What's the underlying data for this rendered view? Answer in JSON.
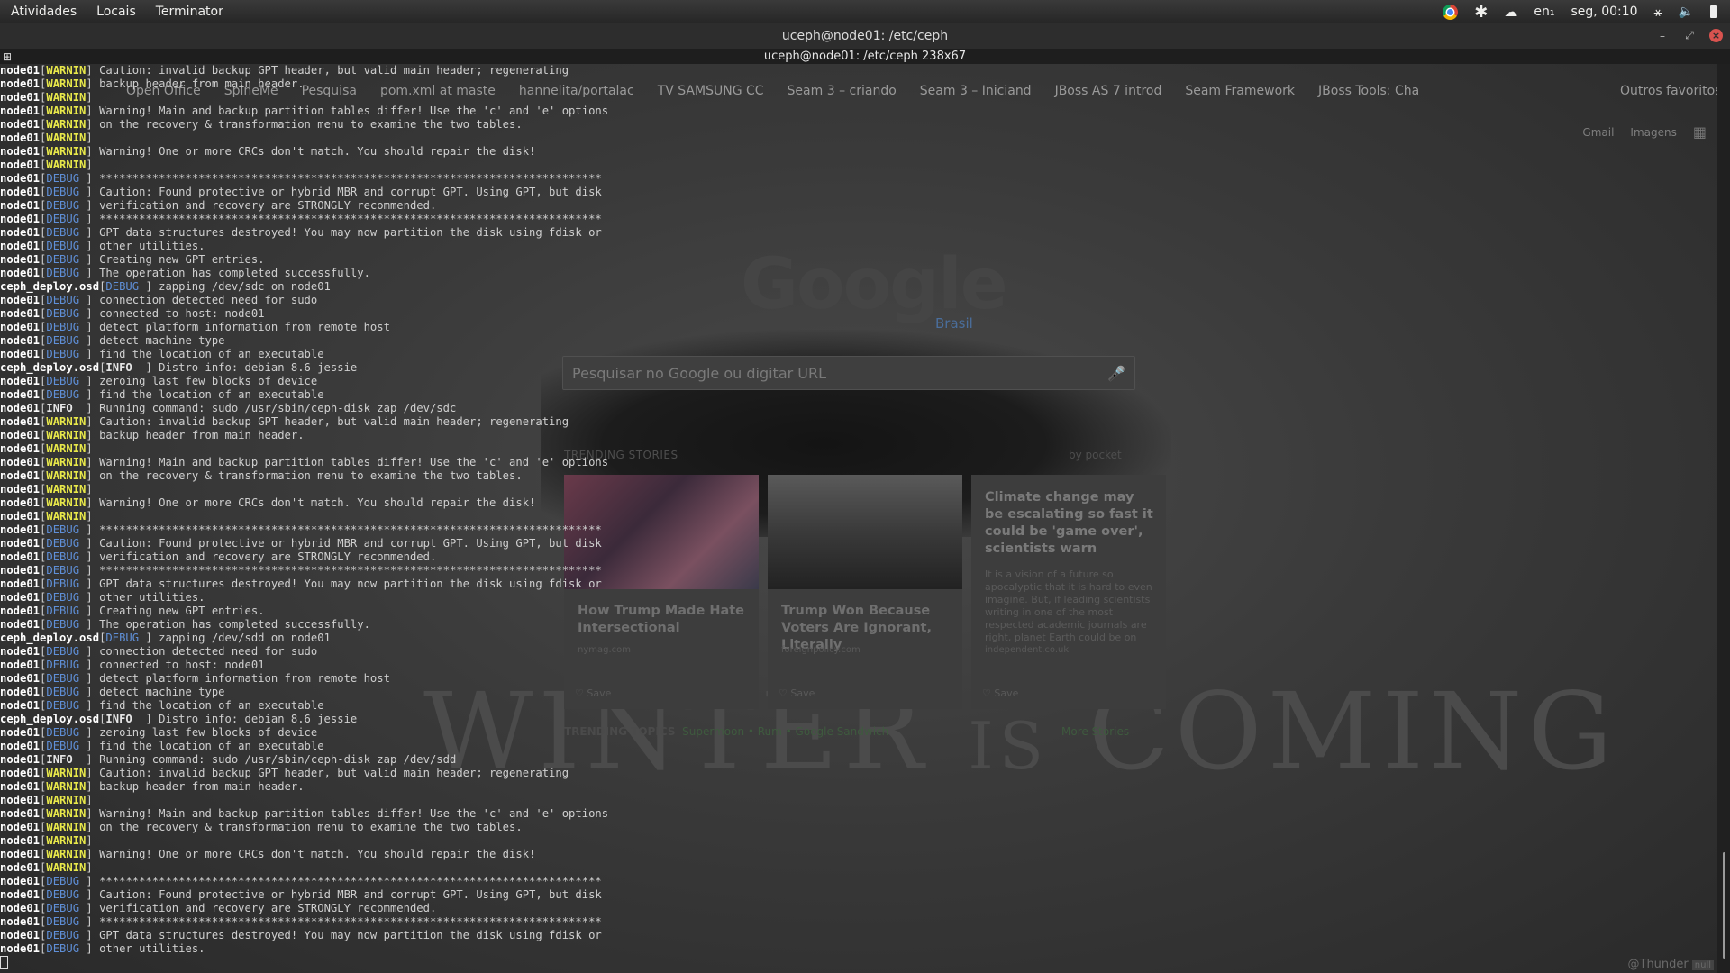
{
  "topbar": {
    "activities": "Atividades",
    "places": "Locais",
    "app": "Terminator",
    "keyboard": "en₁",
    "clock": "seg, 00:10"
  },
  "window": {
    "title": "uceph@node01: /etc/ceph",
    "subtitle": "uceph@node01: /etc/ceph 238x67"
  },
  "browser": {
    "bookmarks": [
      "Open Office",
      "SpineMe",
      "Pesquisa",
      "pom.xml at maste",
      "hannelita/portalac",
      "TV SAMSUNG CC",
      "Seam 3 – criando",
      "Seam 3 – Iniciand",
      "JBoss AS 7 introd",
      "Seam Framework",
      "JBoss Tools: Cha"
    ],
    "other_bookmarks": "Outros favoritos",
    "gmail": "Gmail",
    "images": "Imagens",
    "logo": "Google",
    "country": "Brasil",
    "search_placeholder": "Pesquisar no Google ou digitar URL",
    "trending_title": "TRENDING STORIES",
    "pocket": "by pocket",
    "cards": [
      {
        "title": "How Trump Made Hate Intersectional",
        "source": "nymag.com",
        "save": "Save"
      },
      {
        "title": "Trump Won Because Voters Are Ignorant, Literally",
        "source": "foreignpolicy.com",
        "save": "Save"
      },
      {
        "title": "Climate change may be escalating so fast it could be 'game over', scientists warn",
        "desc": "It is a vision of a future so apocalyptic that it is hard to even imagine. But, if leading scientists writing in one of the most respected academic journals are right, planet Earth could be on",
        "source": "independent.co.uk",
        "save": "Save"
      }
    ],
    "trending_topics_label": "TRENDING TOPICS",
    "trending_topics": "Supermoon • Rum • Google Sandwich",
    "more_stories": "More Stories",
    "wallpaper_text": "WINTER",
    "wallpaper_is": "IS",
    "wallpaper_text2": "COMING",
    "thunder": "@Thunder",
    "thunder_tag": "null"
  },
  "terminal": {
    "lines": [
      [
        "node01",
        "WARNIN",
        "Caution: invalid backup GPT header, but valid main header; regenerating"
      ],
      [
        "node01",
        "WARNIN",
        "backup header from main header."
      ],
      [
        "node01",
        "WARNIN",
        ""
      ],
      [
        "node01",
        "WARNIN",
        "Warning! Main and backup partition tables differ! Use the 'c' and 'e' options"
      ],
      [
        "node01",
        "WARNIN",
        "on the recovery & transformation menu to examine the two tables."
      ],
      [
        "node01",
        "WARNIN",
        ""
      ],
      [
        "node01",
        "WARNIN",
        "Warning! One or more CRCs don't match. You should repair the disk!"
      ],
      [
        "node01",
        "WARNIN",
        ""
      ],
      [
        "node01",
        "DEBUG",
        "****************************************************************************"
      ],
      [
        "node01",
        "DEBUG",
        "Caution: Found protective or hybrid MBR and corrupt GPT. Using GPT, but disk"
      ],
      [
        "node01",
        "DEBUG",
        "verification and recovery are STRONGLY recommended."
      ],
      [
        "node01",
        "DEBUG",
        "****************************************************************************"
      ],
      [
        "node01",
        "DEBUG",
        "GPT data structures destroyed! You may now partition the disk using fdisk or"
      ],
      [
        "node01",
        "DEBUG",
        "other utilities."
      ],
      [
        "node01",
        "DEBUG",
        "Creating new GPT entries."
      ],
      [
        "node01",
        "DEBUG",
        "The operation has completed successfully."
      ],
      [
        "ceph_deploy.osd",
        "DEBUG",
        "zapping /dev/sdc on node01"
      ],
      [
        "node01",
        "DEBUG",
        "connection detected need for sudo"
      ],
      [
        "node01",
        "DEBUG",
        "connected to host: node01"
      ],
      [
        "node01",
        "DEBUG",
        "detect platform information from remote host"
      ],
      [
        "node01",
        "DEBUG",
        "detect machine type"
      ],
      [
        "node01",
        "DEBUG",
        "find the location of an executable"
      ],
      [
        "ceph_deploy.osd",
        "INFO",
        "Distro info: debian 8.6 jessie"
      ],
      [
        "node01",
        "DEBUG",
        "zeroing last few blocks of device"
      ],
      [
        "node01",
        "DEBUG",
        "find the location of an executable"
      ],
      [
        "node01",
        "INFO",
        "Running command: sudo /usr/sbin/ceph-disk zap /dev/sdc"
      ],
      [
        "node01",
        "WARNIN",
        "Caution: invalid backup GPT header, but valid main header; regenerating"
      ],
      [
        "node01",
        "WARNIN",
        "backup header from main header."
      ],
      [
        "node01",
        "WARNIN",
        ""
      ],
      [
        "node01",
        "WARNIN",
        "Warning! Main and backup partition tables differ! Use the 'c' and 'e' options"
      ],
      [
        "node01",
        "WARNIN",
        "on the recovery & transformation menu to examine the two tables."
      ],
      [
        "node01",
        "WARNIN",
        ""
      ],
      [
        "node01",
        "WARNIN",
        "Warning! One or more CRCs don't match. You should repair the disk!"
      ],
      [
        "node01",
        "WARNIN",
        ""
      ],
      [
        "node01",
        "DEBUG",
        "****************************************************************************"
      ],
      [
        "node01",
        "DEBUG",
        "Caution: Found protective or hybrid MBR and corrupt GPT. Using GPT, but disk"
      ],
      [
        "node01",
        "DEBUG",
        "verification and recovery are STRONGLY recommended."
      ],
      [
        "node01",
        "DEBUG",
        "****************************************************************************"
      ],
      [
        "node01",
        "DEBUG",
        "GPT data structures destroyed! You may now partition the disk using fdisk or"
      ],
      [
        "node01",
        "DEBUG",
        "other utilities."
      ],
      [
        "node01",
        "DEBUG",
        "Creating new GPT entries."
      ],
      [
        "node01",
        "DEBUG",
        "The operation has completed successfully."
      ],
      [
        "ceph_deploy.osd",
        "DEBUG",
        "zapping /dev/sdd on node01"
      ],
      [
        "node01",
        "DEBUG",
        "connection detected need for sudo"
      ],
      [
        "node01",
        "DEBUG",
        "connected to host: node01"
      ],
      [
        "node01",
        "DEBUG",
        "detect platform information from remote host"
      ],
      [
        "node01",
        "DEBUG",
        "detect machine type"
      ],
      [
        "node01",
        "DEBUG",
        "find the location of an executable"
      ],
      [
        "ceph_deploy.osd",
        "INFO",
        "Distro info: debian 8.6 jessie"
      ],
      [
        "node01",
        "DEBUG",
        "zeroing last few blocks of device"
      ],
      [
        "node01",
        "DEBUG",
        "find the location of an executable"
      ],
      [
        "node01",
        "INFO",
        "Running command: sudo /usr/sbin/ceph-disk zap /dev/sdd"
      ],
      [
        "node01",
        "WARNIN",
        "Caution: invalid backup GPT header, but valid main header; regenerating"
      ],
      [
        "node01",
        "WARNIN",
        "backup header from main header."
      ],
      [
        "node01",
        "WARNIN",
        ""
      ],
      [
        "node01",
        "WARNIN",
        "Warning! Main and backup partition tables differ! Use the 'c' and 'e' options"
      ],
      [
        "node01",
        "WARNIN",
        "on the recovery & transformation menu to examine the two tables."
      ],
      [
        "node01",
        "WARNIN",
        ""
      ],
      [
        "node01",
        "WARNIN",
        "Warning! One or more CRCs don't match. You should repair the disk!"
      ],
      [
        "node01",
        "WARNIN",
        ""
      ],
      [
        "node01",
        "DEBUG",
        "****************************************************************************"
      ],
      [
        "node01",
        "DEBUG",
        "Caution: Found protective or hybrid MBR and corrupt GPT. Using GPT, but disk"
      ],
      [
        "node01",
        "DEBUG",
        "verification and recovery are STRONGLY recommended."
      ],
      [
        "node01",
        "DEBUG",
        "****************************************************************************"
      ],
      [
        "node01",
        "DEBUG",
        "GPT data structures destroyed! You may now partition the disk using fdisk or"
      ],
      [
        "node01",
        "DEBUG",
        "other utilities."
      ]
    ]
  },
  "colors": {
    "warn": "#e8e84a",
    "debug": "#5f8fd7",
    "info": "#e6e6e6",
    "host": "#ffffff"
  },
  "icons": {
    "topbar": [
      "chrome-icon",
      "settings-icon",
      "weather-icon",
      "key-icon",
      "volume-icon",
      "battery-icon"
    ]
  }
}
